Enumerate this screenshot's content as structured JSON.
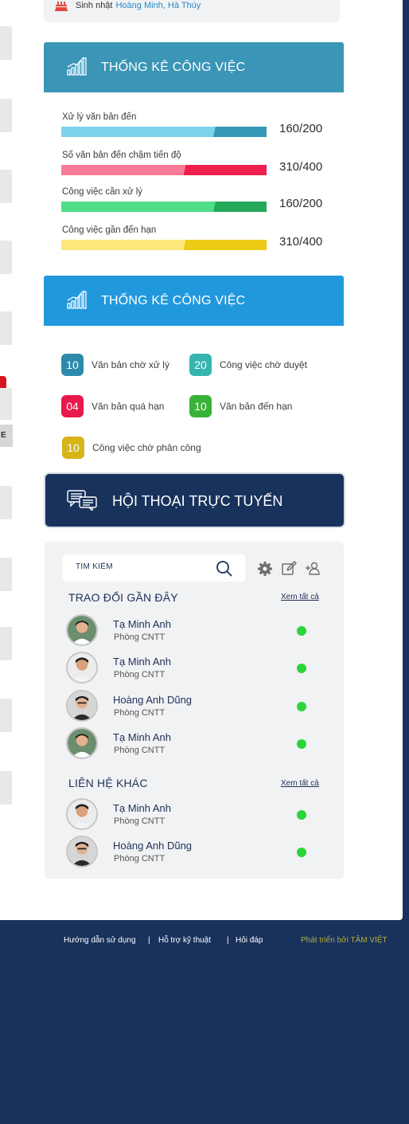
{
  "birthday": {
    "label": "Sinh nhật",
    "names": "Hoàng Minh, Hà Thúy"
  },
  "work_stats": {
    "title": "THỐNG KÊ CÔNG VIỆC",
    "rows": [
      {
        "label": "Xử lý văn bản đến",
        "value_text": "160/200",
        "current": 160,
        "total": 200,
        "light_color": "#7cd3ea",
        "dark_color": "#3497b6"
      },
      {
        "label": "Số văn bản đến chậm tiến độ",
        "value_text": "310/400",
        "current": 310,
        "total": 400,
        "light_color": "#fb7b97",
        "dark_color": "#ee1f4e"
      },
      {
        "label": "Công việc cần xử lý",
        "value_text": "160/200",
        "current": 160,
        "total": 200,
        "light_color": "#4fdf87",
        "dark_color": "#24a85a"
      },
      {
        "label": "Công việc gần đến hạn",
        "value_text": "310/400",
        "current": 310,
        "total": 400,
        "light_color": "#fde67b",
        "dark_color": "#eccb14"
      }
    ]
  },
  "work_counts": {
    "title": "THỐNG KÊ CÔNG VIỆC",
    "items": [
      {
        "count": "10",
        "label": "Văn bản chờ xử lý",
        "color": "#2e8aab"
      },
      {
        "count": "20",
        "label": "Công việc chờ duyệt",
        "color": "#36b4b0"
      },
      {
        "count": "04",
        "label": "Văn bản quá hạn",
        "color": "#e8194c"
      },
      {
        "count": "10",
        "label": "Văn bản đến hạn",
        "color": "#39b238"
      },
      {
        "count": "10",
        "label": "Công việc chờ phân công",
        "color": "#d7b419"
      }
    ]
  },
  "chat": {
    "title": "HỘI THOẠI TRỰC TUYẾN",
    "search_placeholder": "TÌM KIẾM",
    "recent": {
      "title": "TRAO ĐỔI GẦN ĐÂY",
      "see_all": "Xem tất cả",
      "contacts": [
        {
          "name": "Tạ Minh Anh",
          "dept": "Phòng CNTT",
          "status": "online"
        },
        {
          "name": "Tạ Minh Anh",
          "dept": "Phòng CNTT",
          "status": "online"
        },
        {
          "name": "Hoàng Anh Dũng",
          "dept": "Phòng CNTT",
          "status": "online"
        },
        {
          "name": "Tạ Minh Anh",
          "dept": "Phòng CNTT",
          "status": "online"
        }
      ]
    },
    "others": {
      "title": "LIÊN HỆ KHÁC",
      "see_all": "Xem tất cả",
      "contacts": [
        {
          "name": "Tạ Minh Anh",
          "dept": "Phòng CNTT",
          "status": "online"
        },
        {
          "name": "Hoàng Anh Dũng",
          "dept": "Phòng CNTT",
          "status": "online"
        }
      ]
    },
    "online_color": "#2bd439"
  },
  "footer": {
    "links": [
      "Hướng dẫn sử dụng",
      "Hỗ trợ kỹ thuật",
      "Hỏi đáp"
    ],
    "separator": "|",
    "credit": "Phát triển bởi TÂM VIỆT"
  },
  "side_strip": {
    "e_label": "E"
  }
}
